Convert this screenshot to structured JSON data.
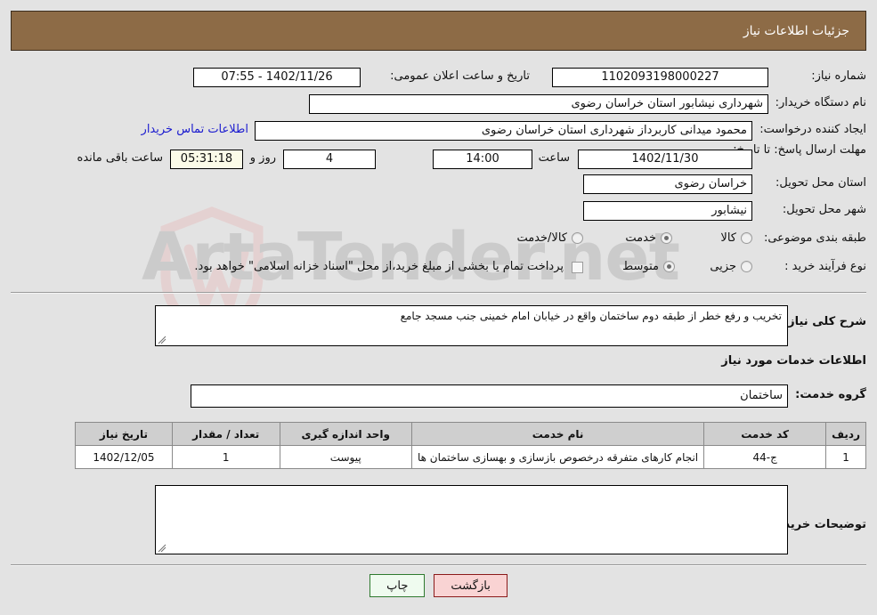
{
  "header": {
    "title": "جزئیات اطلاعات نیاز"
  },
  "watermark": {
    "text": "ArtaTender.net",
    "logo": "shield-logo"
  },
  "form": {
    "need_number_label": "شماره نیاز:",
    "need_number_value": "1102093198000227",
    "public_announce_label": "تاریخ و ساعت اعلان عمومی:",
    "public_announce_value": "1402/11/26 - 07:55",
    "buyer_org_label": "نام دستگاه خریدار:",
    "buyer_org_value": "شهرداری نیشابور استان خراسان رضوی",
    "creator_label": "ایجاد کننده درخواست:",
    "creator_value": "محمود میدانی کاربرداز شهرداری استان خراسان رضوی",
    "contact_link": "اطلاعات تماس خریدار",
    "deadline_label": "مهلت ارسال پاسخ: تا تاریخ:",
    "deadline_date": "1402/11/30",
    "hour_label": "ساعت",
    "hour_value": "14:00",
    "days_value": "4",
    "days_and_label": "روز و",
    "countdown_value": "05:31:18",
    "remaining_label": "ساعت باقی مانده",
    "province_label": "استان محل تحویل:",
    "province_value": "خراسان رضوی",
    "city_label": "شهر محل تحویل:",
    "city_value": "نیشابور",
    "category_label": "طبقه بندی موضوعی:",
    "category_options": [
      "کالا",
      "خدمت",
      "کالا/خدمت"
    ],
    "category_selected": "خدمت",
    "process_label": "نوع فرآیند خرید :",
    "process_options": [
      "جزیی",
      "متوسط"
    ],
    "process_selected": "متوسط",
    "treasury_checkbox_text": "پرداخت تمام یا بخشی از مبلغ خرید،از محل \"اسناد خزانه اسلامی\" خواهد بود.",
    "treasury_checked": false
  },
  "description": {
    "label": "شرح کلی نیاز:",
    "value": "تخریب و رفع خطر از طبقه دوم ساختمان واقع در خیابان امام خمینی جنب مسجد جامع"
  },
  "services_section": {
    "heading": "اطلاعات خدمات مورد نیاز",
    "group_label": "گروه خدمت:",
    "group_value": "ساختمان"
  },
  "table": {
    "columns": [
      "ردیف",
      "کد خدمت",
      "نام خدمت",
      "واحد اندازه گیری",
      "تعداد / مقدار",
      "تاریخ نیاز"
    ],
    "rows": [
      {
        "row_no": "1",
        "service_code": "ج-44",
        "service_name": "انجام کارهای متفرقه درخصوص بازسازی و بهسازی ساختمان ها",
        "unit": "پیوست",
        "quantity": "1",
        "need_date": "1402/12/05"
      }
    ]
  },
  "buyer_notes": {
    "label": "توضیحات خریدار;",
    "value": ""
  },
  "buttons": {
    "back": "بازگشت",
    "print": "چاپ"
  },
  "colors": {
    "header_bg": "#8d6b46",
    "page_bg": "#e3e3e3",
    "link": "#1b1bcf",
    "back_btn_bg": "#f9d3d3",
    "print_btn_bg": "#effbef",
    "table_header_bg": "#cfcfcf",
    "countdown_bg": "#fbfbe8"
  }
}
